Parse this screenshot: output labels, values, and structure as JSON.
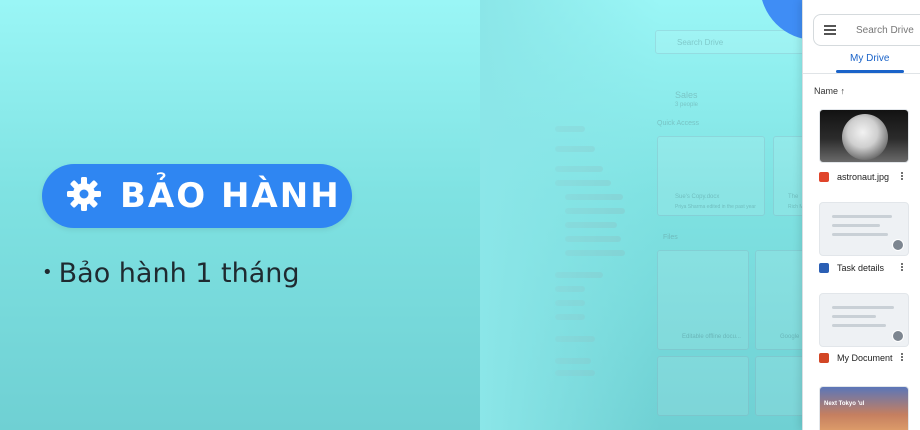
{
  "promo": {
    "badge_label": "BẢO HÀNH",
    "bullet": "•",
    "bullet_text": "Bảo hành 1 tháng"
  },
  "drive_mockup": {
    "search_placeholder": "Search Drive",
    "tab": "My Drive",
    "sort_label": "Name ↑",
    "files": [
      {
        "name": "astronaut.jpg",
        "type": "image",
        "icon": "image-file-icon",
        "color": "#e0452b"
      },
      {
        "name": "Task details",
        "type": "word",
        "icon": "word-file-icon",
        "color": "#2b5fb4"
      },
      {
        "name": "My Document",
        "type": "powerpoint",
        "icon": "powerpoint-file-icon",
        "color": "#d24625"
      },
      {
        "name": "",
        "type": "image",
        "icon": "image-thumbnail"
      }
    ],
    "city_thumb_label": "Next Tokyo 'ul"
  },
  "ghost_mockup": {
    "search": "Search Drive",
    "folder": "Sales",
    "folder_sub": "3 people",
    "quick_access": "Quick Access",
    "file1": "Sue's Copy.docx",
    "file1_sub": "Priya Sharma edited in the past year",
    "file2": "The",
    "file2_sub": "Rich Mey",
    "files_heading": "Files",
    "file3": "Editable offline docu...",
    "file4": "Google"
  },
  "colors": {
    "badge": "#2f86f2",
    "accent": "#1a63c9",
    "bg_top": "#9af6f6",
    "bg_bottom": "#6fd0d3"
  }
}
